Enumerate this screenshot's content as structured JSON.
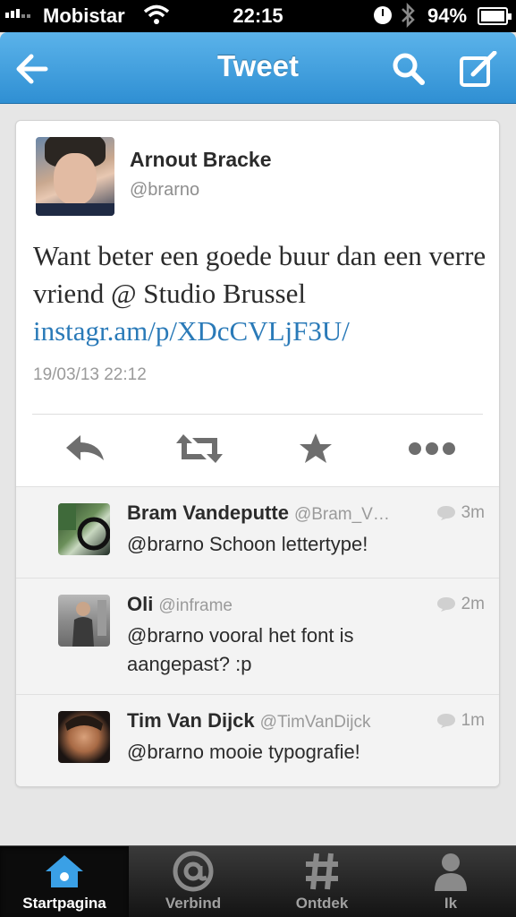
{
  "status_bar": {
    "carrier": "Mobistar",
    "time": "22:15",
    "battery": "94%"
  },
  "nav": {
    "title": "Tweet"
  },
  "tweet": {
    "author_name": "Arnout Bracke",
    "author_handle": "@brarno",
    "text": "Want beter een goede buur dan een verre vriend @ Studio Brussel",
    "link": "instagr.am/p/XDcCVLjF3U/",
    "timestamp": "19/03/13 22:12"
  },
  "replies": [
    {
      "name": "Bram Vandeputte",
      "handle": "@Bram_V…",
      "age": "3m",
      "text": "@brarno Schoon lettertype!"
    },
    {
      "name": "Oli",
      "handle": "@inframe",
      "age": "2m",
      "text": "@brarno vooral het font is aangepast? :p"
    },
    {
      "name": "Tim Van Dijck",
      "handle": "@TimVanDijck",
      "age": "1m",
      "text": "@brarno mooie typografie!"
    }
  ],
  "tabs": [
    {
      "label": "Startpagina",
      "icon": "home-icon",
      "active": true
    },
    {
      "label": "Verbind",
      "icon": "at-icon",
      "active": false
    },
    {
      "label": "Ontdek",
      "icon": "hash-icon",
      "active": false
    },
    {
      "label": "Ik",
      "icon": "person-icon",
      "active": false
    }
  ],
  "colors": {
    "nav_blue": "#2f8fd3",
    "link_blue": "#2a7ab8"
  }
}
